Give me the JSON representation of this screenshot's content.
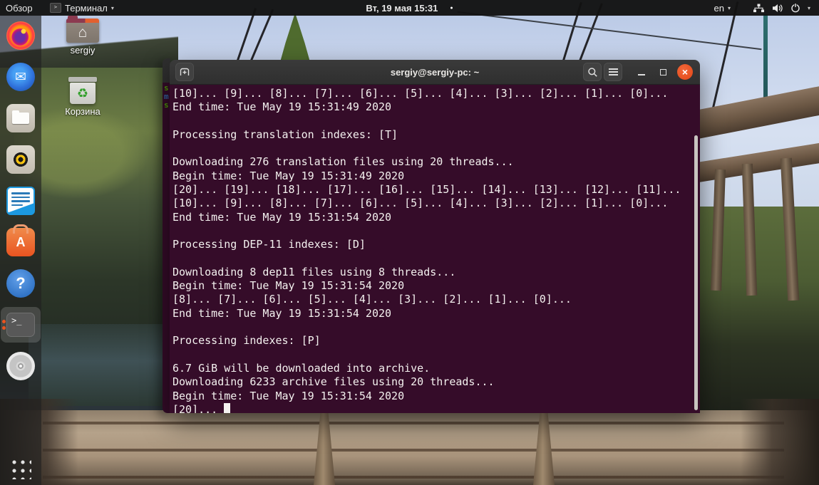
{
  "top_bar": {
    "activities_label": "Обзор",
    "app_menu_label": "Терминал",
    "app_menu_caret": "▾",
    "clock_text": "Вт, 19 мая 15:31",
    "notification_dot": "●",
    "keyboard_layout": "en",
    "keyboard_caret": "▾",
    "status_caret": "▾",
    "icons": [
      "terminal-mini-icon",
      "wired-network-icon",
      "speaker-icon",
      "power-icon"
    ]
  },
  "desktop": {
    "icons": [
      {
        "label": "sergiy",
        "glyph": "⌂",
        "type": "home-folder"
      },
      {
        "label": "Корзина",
        "glyph": "♻",
        "type": "trash"
      }
    ]
  },
  "dock": {
    "items": [
      "firefox",
      "thunderbird",
      "files",
      "rhythmbox",
      "libreoffice-writer",
      "ubuntu-software",
      "help",
      "terminal",
      "disc",
      "app-grid"
    ],
    "thunderbird_glyph": "✉",
    "software_glyph": "A",
    "help_glyph": "?",
    "terminal_glyph": ">_",
    "active_item": "terminal",
    "running_dots": 2
  },
  "background_window": {
    "fragments": [
      "s",
      "m",
      "s"
    ]
  },
  "terminal": {
    "title": "sergiy@sergiy-pc: ~",
    "window_controls": {
      "close": "×"
    },
    "lines": [
      "[10]... [9]... [8]... [7]... [6]... [5]... [4]... [3]... [2]... [1]... [0]...",
      "End time: Tue May 19 15:31:49 2020",
      "",
      "Processing translation indexes: [T]",
      "",
      "Downloading 276 translation files using 20 threads...",
      "Begin time: Tue May 19 15:31:49 2020",
      "[20]... [19]... [18]... [17]... [16]... [15]... [14]... [13]... [12]... [11]...",
      "[10]... [9]... [8]... [7]... [6]... [5]... [4]... [3]... [2]... [1]... [0]...",
      "End time: Tue May 19 15:31:54 2020",
      "",
      "Processing DEP-11 indexes: [D]",
      "",
      "Downloading 8 dep11 files using 8 threads...",
      "Begin time: Tue May 19 15:31:54 2020",
      "[8]... [7]... [6]... [5]... [4]... [3]... [2]... [1]... [0]...",
      "End time: Tue May 19 15:31:54 2020",
      "",
      "Processing indexes: [P]",
      "",
      "6.7 GiB will be downloaded into archive.",
      "Downloading 6233 archive files using 20 threads...",
      "Begin time: Tue May 19 15:31:54 2020"
    ],
    "cursor_line": "[20]... "
  },
  "colors": {
    "accent_orange": "#e95420",
    "terminal_background": "#350c29",
    "terminal_text": "#f4f1ef",
    "titlebar_background": "#343434",
    "topbar_background": "#121212",
    "fragment_green": "#4e9a06",
    "fragment_blue": "#3465a4",
    "scrollbar": "#c8c5c0"
  }
}
